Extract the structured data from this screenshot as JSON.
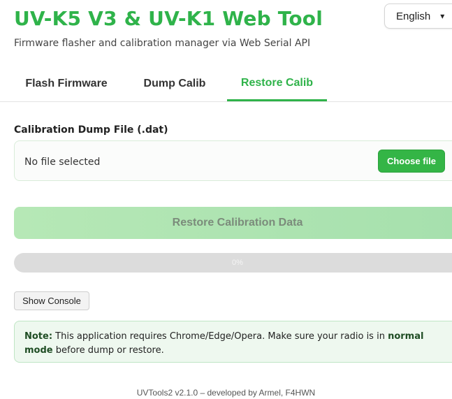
{
  "header": {
    "title": "UV-K5 V3 & UV-K1 Web Tool",
    "subtitle": "Firmware flasher and calibration manager via Web Serial API",
    "language": {
      "selected": "English",
      "icon": "chevron-down-icon"
    }
  },
  "tabs": [
    {
      "label": "Flash Firmware",
      "active": false
    },
    {
      "label": "Dump Calib",
      "active": false
    },
    {
      "label": "Restore Calib",
      "active": true
    }
  ],
  "restore_panel": {
    "file_label": "Calibration Dump File (.dat)",
    "file_status": "No file selected",
    "choose_file_label": "Choose file",
    "restore_button_label": "Restore Calibration Data",
    "progress": {
      "value": 0,
      "text": "0%"
    },
    "console_button_label": "Show Console"
  },
  "note": {
    "prefix": "Note:",
    "text_before": " This application requires Chrome/Edge/Opera. Make sure your radio is in ",
    "emphasis": "normal mode",
    "text_after": " before dump or restore."
  },
  "footer": "UVTools2 v2.1.0 – developed by Armel, F4HWN",
  "colors": {
    "accent": "#2fb34a",
    "button_green": "#34b546",
    "disabled_green": "#b6e8b6",
    "note_bg": "#eef8ef",
    "progress_track": "#dcdcdc"
  }
}
